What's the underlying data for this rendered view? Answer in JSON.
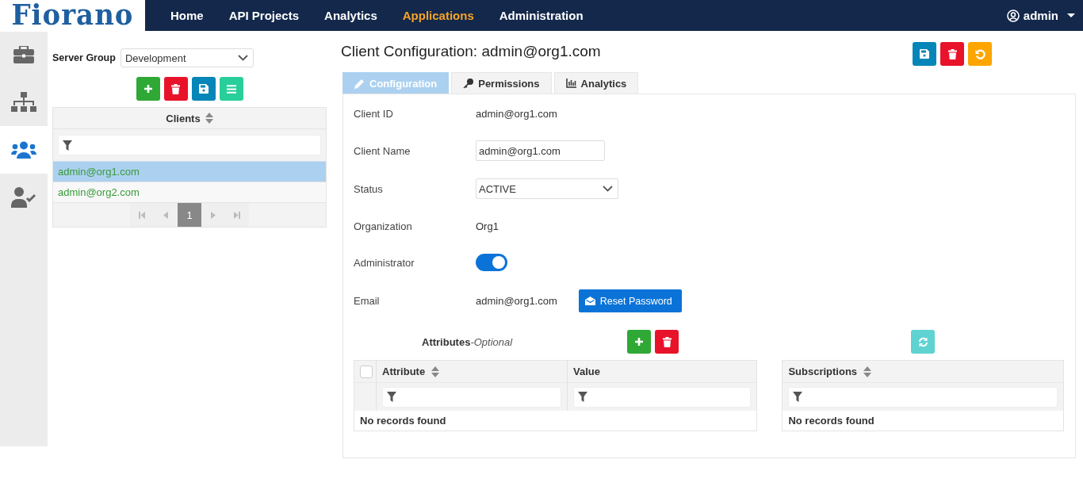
{
  "logo": "Fiorano",
  "nav": [
    {
      "label": "Home",
      "selected": false
    },
    {
      "label": "API Projects",
      "selected": false
    },
    {
      "label": "Analytics",
      "selected": false
    },
    {
      "label": "Applications",
      "selected": true
    },
    {
      "label": "Administration",
      "selected": false
    }
  ],
  "user": "admin",
  "rail": [
    {
      "kind": "briefcase",
      "selected": false
    },
    {
      "kind": "sitemap",
      "selected": false
    },
    {
      "kind": "users",
      "selected": true
    },
    {
      "kind": "user-check",
      "selected": false
    }
  ],
  "server_group": {
    "label": "Server Group",
    "value": "Development"
  },
  "list_buttons": [
    {
      "kind": "add"
    },
    {
      "kind": "delete"
    },
    {
      "kind": "save"
    },
    {
      "kind": "menu"
    }
  ],
  "clients": {
    "column": "Clients",
    "rows": [
      {
        "text": "admin@org1.com",
        "selected": true
      },
      {
        "text": "admin@org2.com",
        "selected": false
      }
    ],
    "page": "1"
  },
  "title": "Client Configuration: admin@org1.com",
  "header_buttons": [
    {
      "kind": "save"
    },
    {
      "kind": "delete"
    },
    {
      "kind": "undo"
    }
  ],
  "tabs": [
    {
      "label": "Configuration",
      "kind": "pencil",
      "selected": true
    },
    {
      "label": "Permissions",
      "kind": "key",
      "selected": false
    },
    {
      "label": "Analytics",
      "kind": "chart",
      "selected": false
    }
  ],
  "fields": [
    {
      "kind": "text",
      "label": "Client ID",
      "value": "admin@org1.com"
    },
    {
      "kind": "input",
      "label": "Client Name",
      "value": "admin@org1.com"
    },
    {
      "kind": "select",
      "label": "Status",
      "value": "ACTIVE"
    },
    {
      "kind": "text",
      "label": "Organization",
      "value": "Org1"
    },
    {
      "kind": "toggle",
      "label": "Administrator",
      "on": true
    },
    {
      "kind": "email",
      "label": "Email",
      "value": "admin@org1.com",
      "button": "Reset Password"
    }
  ],
  "attributes": {
    "title": "Attributes",
    "subtitle": "-Optional",
    "buttons": [
      {
        "kind": "add"
      },
      {
        "kind": "delete"
      }
    ],
    "select_all": false,
    "columns": [
      "Attribute",
      "Value"
    ],
    "empty": "No records found"
  },
  "subscriptions": {
    "buttons": [
      {
        "kind": "refresh"
      }
    ],
    "column": "Subscriptions",
    "empty": "No records found"
  }
}
